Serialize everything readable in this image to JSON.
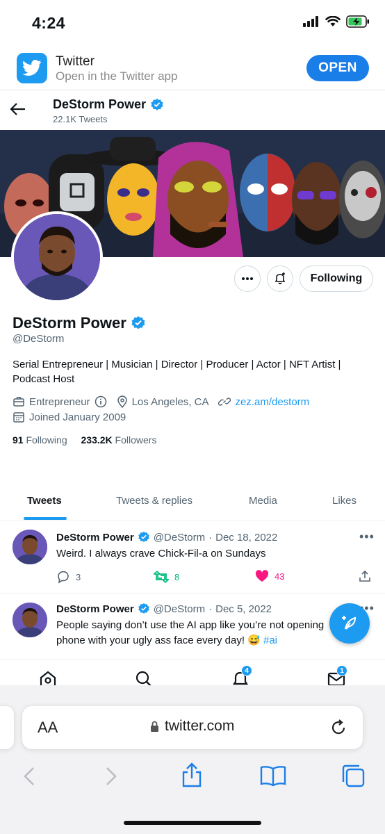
{
  "status_bar": {
    "time": "4:24"
  },
  "app_banner": {
    "title": "Twitter",
    "subtitle": "Open in the Twitter app",
    "button": "OPEN"
  },
  "header": {
    "name": "DeStorm Power",
    "tweet_count": "22.1K Tweets"
  },
  "profile": {
    "name": "DeStorm Power",
    "handle": "@DeStorm",
    "bio_line1": "Serial Entrepreneur | Musician | Director | Producer | Actor | NFT Artist |",
    "bio_line2": "Podcast Host",
    "category": "Entrepreneur",
    "location": "Los Angeles, CA",
    "website": "zez.am/destorm",
    "joined": "Joined January 2009",
    "following_count": "91",
    "following_label": "Following",
    "followers_count": "233.2K",
    "followers_label": "Followers",
    "follow_button": "Following"
  },
  "tabs": [
    "Tweets",
    "Tweets & replies",
    "Media",
    "Likes"
  ],
  "tweets": [
    {
      "name": "DeStorm Power",
      "handle": "@DeStorm",
      "sep": "·",
      "date": "Dec 18, 2022",
      "text": "Weird. I always crave Chick-Fil-a on Sundays",
      "replies": "3",
      "retweets": "8",
      "likes": "43"
    },
    {
      "name": "DeStorm Power",
      "handle": "@DeStorm",
      "sep": "·",
      "date": "Dec 5, 2022",
      "text_line1": "People saying don’t use the AI app like you’re not opening",
      "text_line2": "phone with your ugly ass face every day! 😅",
      "hashtag": "#ai"
    }
  ],
  "bottom_nav": {
    "notifications_badge": "4",
    "messages_badge": "1"
  },
  "safari": {
    "text_size": "AA",
    "url": "twitter.com"
  },
  "colors": {
    "accent": "#1d9bf0",
    "like": "#f91880",
    "retweet": "#00ba7c",
    "open_button": "#1a7ee8"
  }
}
